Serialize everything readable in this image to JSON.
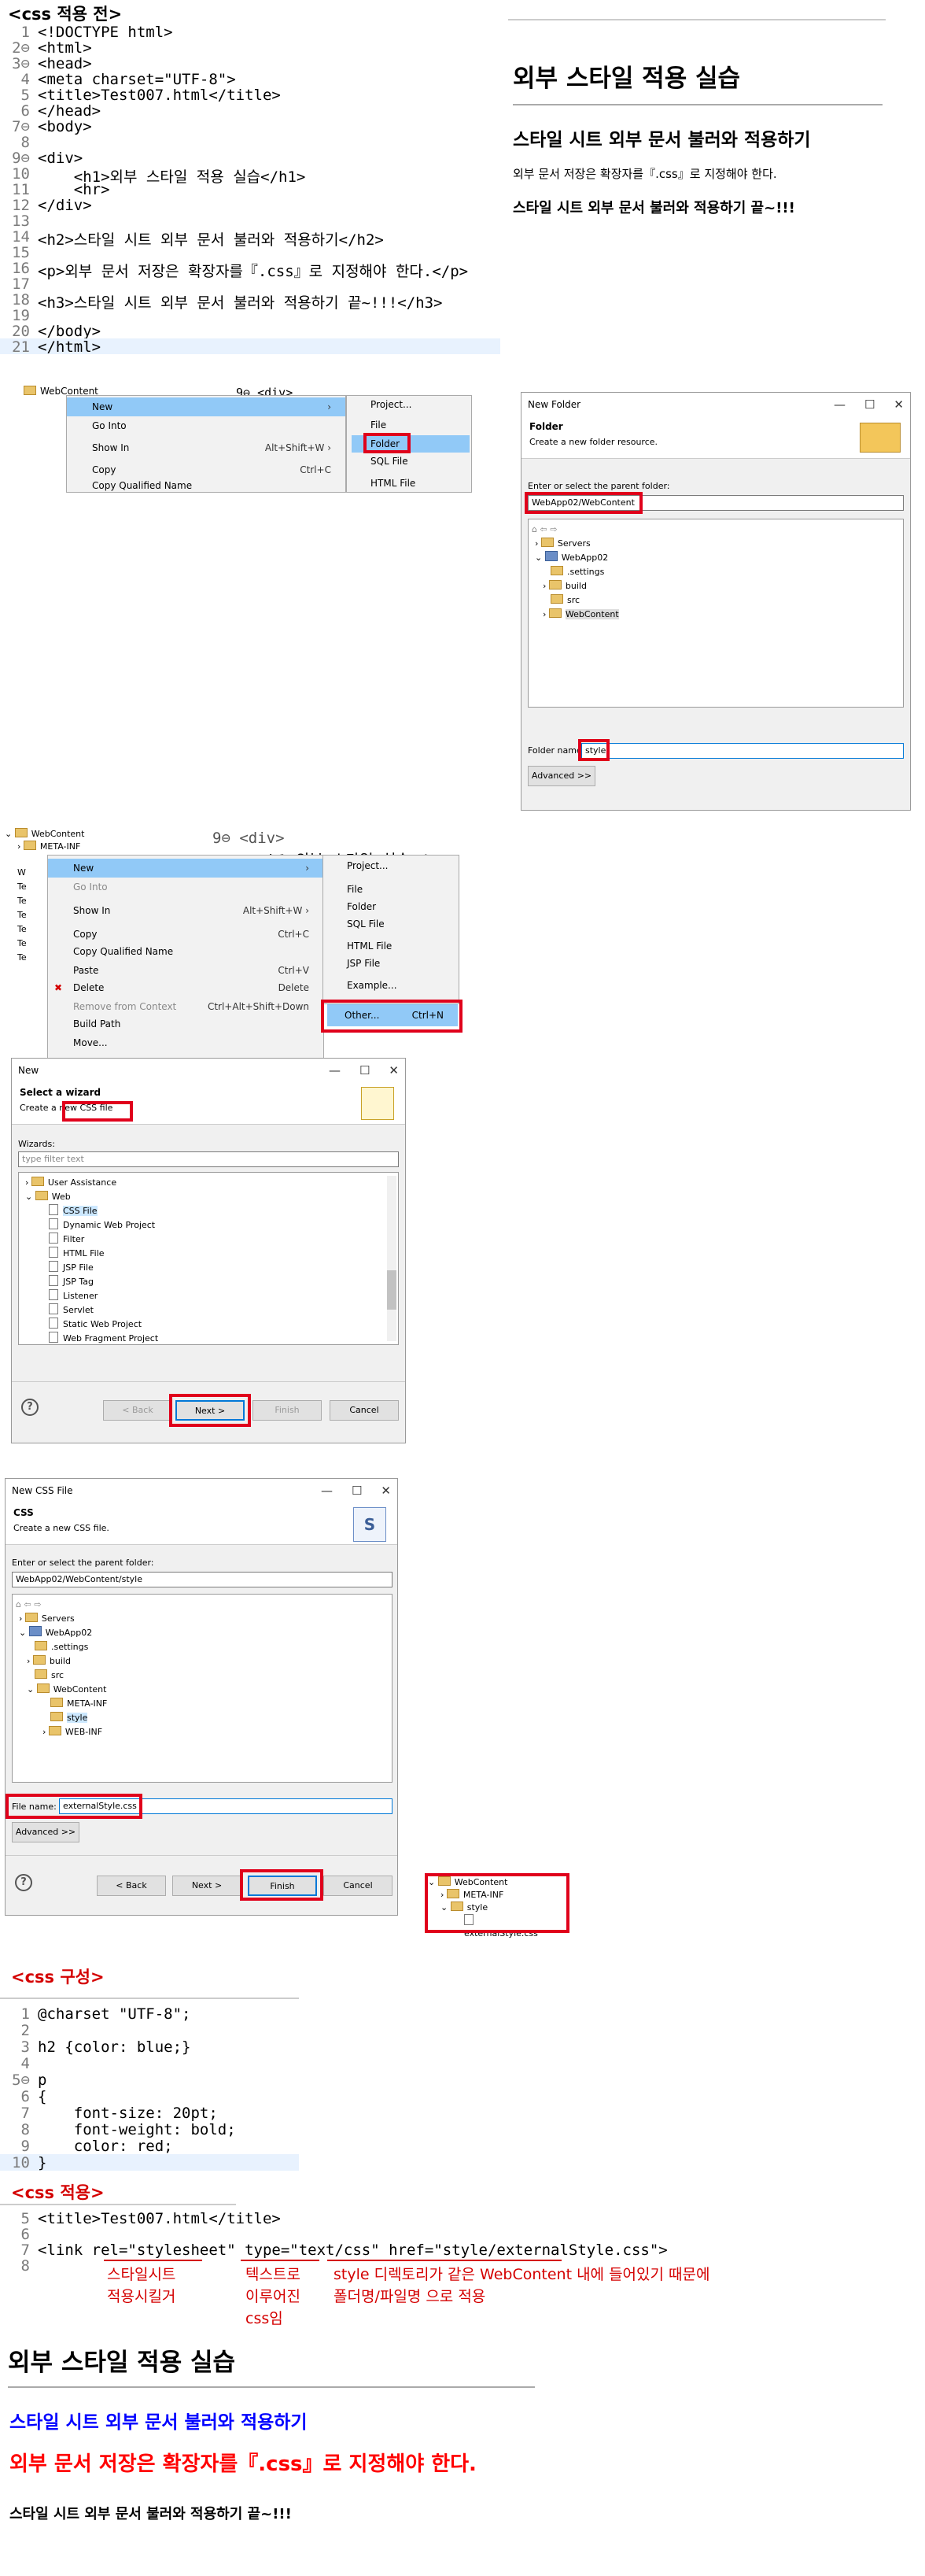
{
  "sections": {
    "before": "<css 적용 전>",
    "compose": "<css 구성>",
    "apply": "<css 적용>"
  },
  "editor1": {
    "lines": [
      {
        "n": "1",
        "t": "<!DOCTYPE html>"
      },
      {
        "n": "2⊖",
        "t": "<html>"
      },
      {
        "n": "3⊖",
        "t": "<head>"
      },
      {
        "n": "4",
        "t": "<meta charset=\"UTF-8\">"
      },
      {
        "n": "5",
        "t": "<title>Test007.html</title>"
      },
      {
        "n": "6",
        "t": "</head>"
      },
      {
        "n": "7⊖",
        "t": "<body>"
      },
      {
        "n": "8",
        "t": ""
      },
      {
        "n": "9⊖",
        "t": "<div>"
      },
      {
        "n": "10",
        "t": "    <h1>외부 스타일 적용 실습</h1>"
      },
      {
        "n": "11",
        "t": "    <hr>"
      },
      {
        "n": "12",
        "t": "</div>"
      },
      {
        "n": "13",
        "t": ""
      },
      {
        "n": "14",
        "t": "<h2>스타일 시트 외부 문서 불러와 적용하기</h2>"
      },
      {
        "n": "15",
        "t": ""
      },
      {
        "n": "16",
        "t": "<p>외부 문서 저장은 확장자를『.css』로 지정해야 한다.</p>"
      },
      {
        "n": "17",
        "t": ""
      },
      {
        "n": "18",
        "t": "<h3>스타일 시트 외부 문서 불러와 적용하기 끝~!!!</h3>"
      },
      {
        "n": "19",
        "t": ""
      },
      {
        "n": "20",
        "t": "</body>"
      },
      {
        "n": "21",
        "t": "</html>"
      }
    ]
  },
  "preview1": {
    "h1": "외부 스타일 적용 실습",
    "h2": "스타일 시트 외부 문서 불러와 적용하기",
    "p": "외부 문서 저장은 확장자를『.css』로 지정해야 한다.",
    "h3": "스타일 시트 외부 문서 불러와 적용하기 끝~!!!"
  },
  "menu1": {
    "tree_item": "WebContent",
    "items": [
      {
        "label": "New",
        "shortcut": ""
      },
      {
        "label": "Go Into",
        "shortcut": ""
      },
      {
        "label": "Show In",
        "shortcut": "Alt+Shift+W ›"
      },
      {
        "label": "Copy",
        "shortcut": "Ctrl+C"
      },
      {
        "label": "Copy Qualified Name",
        "shortcut": ""
      }
    ],
    "sub": [
      "Project...",
      "File",
      "Folder",
      "SQL File",
      "HTML File"
    ],
    "editor_peek": "9⊖ <div>"
  },
  "newFolder": {
    "title": "New Folder",
    "heading": "Folder",
    "desc": "Create a new folder resource.",
    "parent_label": "Enter or select the parent folder:",
    "parent_value": "WebApp02/WebContent",
    "tree": [
      "Servers",
      "WebApp02",
      ".settings",
      "build",
      "src",
      "WebContent"
    ],
    "name_label": "Folder name:",
    "name_value": "style",
    "advanced": "Advanced >>"
  },
  "menu2": {
    "tree": [
      "WebContent",
      "META-INF",
      "W",
      "Te",
      "Te",
      "Te",
      "Te",
      "Te",
      "Te"
    ],
    "items": [
      {
        "label": "New",
        "shortcut": ""
      },
      {
        "label": "Go Into",
        "shortcut": ""
      },
      {
        "label": "Show In",
        "shortcut": "Alt+Shift+W ›"
      },
      {
        "label": "Copy",
        "shortcut": "Ctrl+C"
      },
      {
        "label": "Copy Qualified Name",
        "shortcut": ""
      },
      {
        "label": "Paste",
        "shortcut": "Ctrl+V"
      },
      {
        "label": "Delete",
        "shortcut": "Delete"
      },
      {
        "label": "Remove from Context",
        "shortcut": "Ctrl+Alt+Shift+Down"
      },
      {
        "label": "Build Path",
        "shortcut": ""
      },
      {
        "label": "Move...",
        "shortcut": ""
      }
    ],
    "sub": [
      "Project...",
      "File",
      "Folder",
      "SQL File",
      "HTML File",
      "JSP File",
      "Example...",
      "Other..."
    ],
    "sub_other_shortcut": "Ctrl+N",
    "editor_peek": "9⊖ <div>",
    "editor_peek2": "<h1>외부 스타일 실습</"
  },
  "wizard": {
    "title": "New",
    "heading": "Select a wizard",
    "desc": "Create a new CSS file",
    "wizards_label": "Wizards:",
    "filter_placeholder": "type filter text",
    "tree": [
      "User Assistance",
      "Web",
      "CSS File",
      "Dynamic Web Project",
      "Filter",
      "HTML File",
      "JSP File",
      "JSP Tag",
      "Listener",
      "Servlet",
      "Static Web Project",
      "Web Fragment Project"
    ],
    "back": "< Back",
    "next": "Next >",
    "finish": "Finish",
    "cancel": "Cancel"
  },
  "newCss": {
    "title": "New CSS File",
    "heading": "CSS",
    "desc": "Create a new CSS file.",
    "parent_label": "Enter or select the parent folder:",
    "parent_value": "WebApp02/WebContent/style",
    "tree": [
      "Servers",
      "WebApp02",
      ".settings",
      "build",
      "src",
      "WebContent",
      "META-INF",
      "style",
      "WEB-INF"
    ],
    "name_label": "File name:",
    "name_value": "externalStyle.css",
    "advanced": "Advanced >>",
    "back": "< Back",
    "next": "Next >",
    "finish": "Finish",
    "cancel": "Cancel"
  },
  "result_tree": [
    "WebContent",
    "META-INF",
    "style",
    "externalStyle.css"
  ],
  "editor2": {
    "lines": [
      {
        "n": "1",
        "t": "@charset \"UTF-8\";"
      },
      {
        "n": "2",
        "t": ""
      },
      {
        "n": "3",
        "t": "h2 {color: blue;}"
      },
      {
        "n": "4",
        "t": ""
      },
      {
        "n": "5⊖",
        "t": "p"
      },
      {
        "n": "6",
        "t": "{"
      },
      {
        "n": "7",
        "t": "    font-size: 20pt;"
      },
      {
        "n": "8",
        "t": "    font-weight: bold;"
      },
      {
        "n": "9",
        "t": "    color: red;"
      },
      {
        "n": "10",
        "t": "}"
      }
    ]
  },
  "editor3": {
    "lines": [
      {
        "n": "5",
        "t": "<title>Test007.html</title>"
      },
      {
        "n": "6",
        "t": ""
      },
      {
        "n": "7",
        "t": "<link rel=\"stylesheet\" type=\"text/css\" href=\"style/externalStyle.css\">"
      },
      {
        "n": "8",
        "t": ""
      }
    ]
  },
  "annotations": {
    "a1": [
      "스타일시트",
      "적용시킬거"
    ],
    "a2": [
      "텍스트로",
      "이루어진",
      "css임"
    ],
    "a3": [
      "style 디렉토리가 같은 WebContent 내에 들어있기 때문에",
      "폴더명/파일명 으로 적용"
    ]
  },
  "preview2": {
    "h1": "외부 스타일 적용 실습",
    "h2": "스타일 시트 외부 문서 불러와 적용하기",
    "p": "외부 문서 저장은 확장자를『.css』로 지정해야 한다.",
    "h3": "스타일 시트 외부 문서 불러와 적용하기 끝~!!!",
    "h2_color": "#0000ff",
    "p_color": "#ff0000"
  },
  "colors": {
    "accent_red": "#e0001b",
    "selection": "#91c9f7",
    "line_highlight": "#e8f2fe"
  }
}
